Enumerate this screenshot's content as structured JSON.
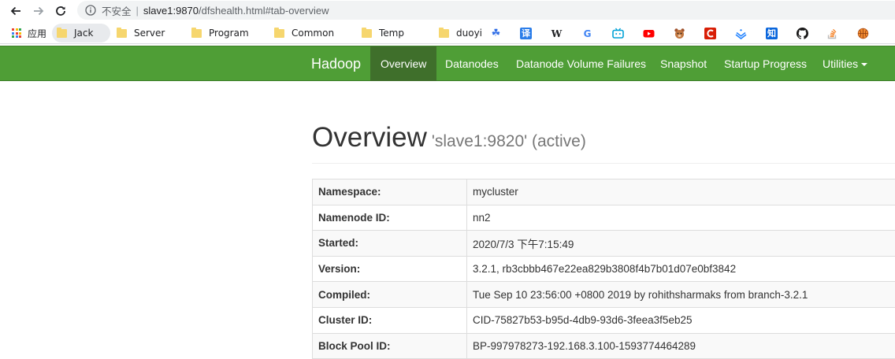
{
  "browser": {
    "security_label": "不安全",
    "separator": "|",
    "url_host": "slave1:9870",
    "url_path": "/dfshealth.html#tab-overview",
    "bookmarks": {
      "apps": "应用",
      "folders": [
        "Jack",
        "Server",
        "Program",
        "Common",
        "Temp",
        "duoyi"
      ],
      "wikipedia_glyph": "W",
      "google_glyph": "G",
      "translate_glyph": "译",
      "zhihu_glyph": "知"
    }
  },
  "navbar": {
    "brand": "Hadoop",
    "items": [
      "Overview",
      "Datanodes",
      "Datanode Volume Failures",
      "Snapshot",
      "Startup Progress",
      "Utilities"
    ],
    "active": "Overview",
    "color": "#4f9e36"
  },
  "overview": {
    "title": "Overview",
    "subtitle": "'slave1:9820' (active)",
    "rows": [
      {
        "key": "Namespace:",
        "value": "mycluster"
      },
      {
        "key": "Namenode ID:",
        "value": "nn2"
      },
      {
        "key": "Started:",
        "value": "2020/7/3 下午7:15:49"
      },
      {
        "key": "Version:",
        "value": "3.2.1, rb3cbbb467e22ea829b3808f4b7b01d07e0bf3842"
      },
      {
        "key": "Compiled:",
        "value": "Tue Sep 10 23:56:00 +0800 2019 by rohithsharmaks from branch-3.2.1"
      },
      {
        "key": "Cluster ID:",
        "value": "CID-75827b53-b95d-4db9-93d6-3feea3f5eb25"
      },
      {
        "key": "Block Pool ID:",
        "value": "BP-997978273-192.168.3.100-1593774464289"
      }
    ]
  }
}
